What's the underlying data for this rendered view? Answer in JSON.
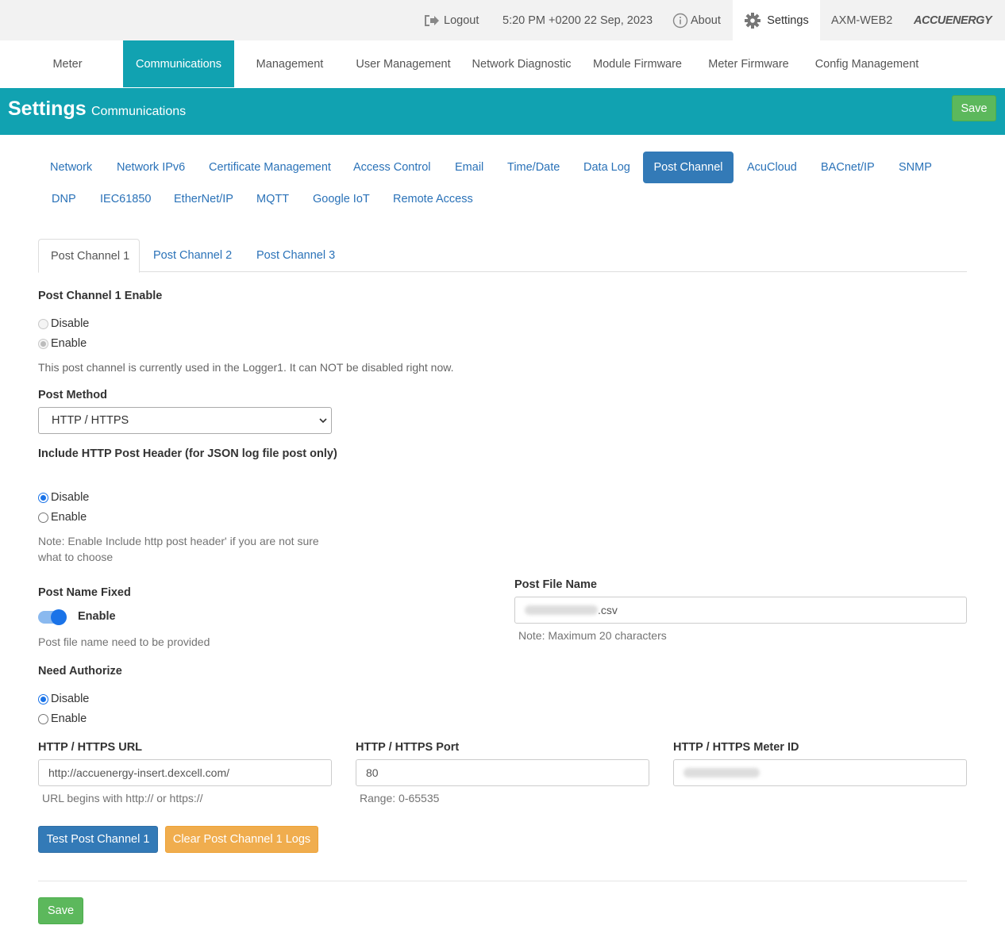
{
  "topbar": {
    "logout": "Logout",
    "datetime": "5:20 PM +0200 22 Sep, 2023",
    "about": "About",
    "settings": "Settings",
    "device": "AXM-WEB2",
    "logo": "ACCUENERGY"
  },
  "mainnav": [
    "Meter",
    "Communications",
    "Management",
    "User Management",
    "Network Diagnostic",
    "Module Firmware",
    "Meter Firmware",
    "Config Management"
  ],
  "header": {
    "title": "Settings",
    "subtitle": "Communications",
    "save": "Save"
  },
  "subtabs_row1": [
    "Network",
    "Network IPv6",
    "Certificate Management",
    "Access Control",
    "Email",
    "Time/Date",
    "Data Log",
    "Post Channel",
    "AcuCloud",
    "BACnet/IP",
    "SNMP"
  ],
  "subtabs_row2": [
    "DNP",
    "IEC61850",
    "EtherNet/IP",
    "MQTT",
    "Google IoT",
    "Remote Access"
  ],
  "channel_tabs": [
    "Post Channel 1",
    "Post Channel 2",
    "Post Channel 3"
  ],
  "form": {
    "enable_label": "Post Channel 1 Enable",
    "disable": "Disable",
    "enable": "Enable",
    "in_use_note": "This post channel is currently used in the Logger1. It can NOT be disabled right now.",
    "method_label": "Post Method",
    "method_value": "HTTP / HTTPS",
    "header_label": "Include HTTP Post Header (for JSON log file post only)",
    "header_note": "Note: Enable Include http post header' if you are not sure what to choose",
    "name_fixed_label": "Post Name Fixed",
    "name_fixed_toggle": "Enable",
    "name_fixed_help": "Post file name need to be provided",
    "file_name_label": "Post File Name",
    "file_name_suffix": ".csv",
    "file_name_note": "Note: Maximum 20 characters",
    "authorize_label": "Need Authorize",
    "url_label": "HTTP / HTTPS URL",
    "url_value": "http://accuenergy-insert.dexcell.com/",
    "url_help": "URL begins with http:// or https://",
    "port_label": "HTTP / HTTPS Port",
    "port_value": "80",
    "port_help": "Range: 0-65535",
    "meter_id_label": "HTTP / HTTPS Meter ID",
    "test_button": "Test Post Channel 1",
    "clear_button": "Clear Post Channel 1 Logs",
    "save_button": "Save"
  },
  "colors": {
    "teal": "#11a2b1",
    "blue": "#337ab7",
    "green": "#5cb85c",
    "orange": "#f0ad4e"
  }
}
